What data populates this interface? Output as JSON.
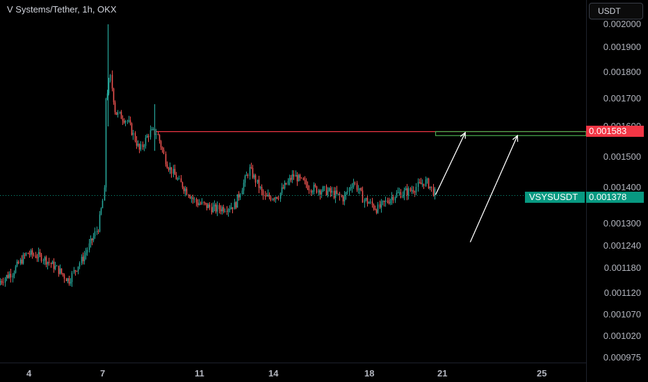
{
  "header": {
    "symbol_title": "V Systems/Tether, 1h, OKX",
    "currency_button": "USDT"
  },
  "colors": {
    "background": "#000000",
    "up": "#26a69a",
    "down": "#ef5350",
    "resistance_line": "#f23645",
    "current_price": "#089981"
  },
  "price_axis": {
    "labels": [
      "0.002000",
      "0.001900",
      "0.001800",
      "0.001700",
      "0.001600",
      "0.001500",
      "0.001400",
      "0.001300",
      "0.001240",
      "0.001180",
      "0.001120",
      "0.001070",
      "0.001020",
      "0.000975"
    ]
  },
  "price_tags": {
    "resistance_value": "0.001583",
    "ticker_label": "VSYSUSDT",
    "last_price": "0.001378"
  },
  "time_axis": {
    "labels": [
      "4",
      "7",
      "11",
      "14",
      "18",
      "21",
      "25"
    ]
  },
  "chart_data": {
    "type": "candlestick",
    "title": "V Systems/Tether, 1h, OKX",
    "x_unit": "day of month",
    "x_ticks": [
      "4",
      "7",
      "11",
      "14",
      "18",
      "21",
      "25"
    ],
    "y_ticks": [
      0.002,
      0.0019,
      0.0018,
      0.0017,
      0.0016,
      0.0015,
      0.0014,
      0.0013,
      0.00124,
      0.00118,
      0.00112,
      0.00107,
      0.00102,
      0.000975
    ],
    "price_path": [
      [
        2.6,
        0.00114
      ],
      [
        3.3,
        0.00117
      ],
      [
        3.9,
        0.00122
      ],
      [
        4.5,
        0.00121
      ],
      [
        5.1,
        0.00118
      ],
      [
        5.6,
        0.00115
      ],
      [
        6.2,
        0.00121
      ],
      [
        6.8,
        0.00129
      ],
      [
        7.05,
        0.00139
      ],
      [
        7.1,
        0.0017
      ],
      [
        7.3,
        0.00178
      ],
      [
        7.5,
        0.00165
      ],
      [
        8.0,
        0.00162
      ],
      [
        8.5,
        0.00152
      ],
      [
        8.9,
        0.00158
      ],
      [
        9.2,
        0.00158
      ],
      [
        9.6,
        0.00148
      ],
      [
        10.1,
        0.00142
      ],
      [
        10.8,
        0.00136
      ],
      [
        11.6,
        0.00134
      ],
      [
        12.4,
        0.00135
      ],
      [
        13.0,
        0.00146
      ],
      [
        13.6,
        0.00137
      ],
      [
        14.2,
        0.00138
      ],
      [
        14.8,
        0.00144
      ],
      [
        15.5,
        0.0014
      ],
      [
        16.2,
        0.00139
      ],
      [
        16.9,
        0.00137
      ],
      [
        17.3,
        0.00142
      ],
      [
        17.7,
        0.00137
      ],
      [
        18.3,
        0.00134
      ],
      [
        19.0,
        0.00138
      ],
      [
        19.6,
        0.00139
      ],
      [
        20.3,
        0.00142
      ],
      [
        20.7,
        0.001378
      ]
    ],
    "spikes": [
      {
        "x": 7.2,
        "high": 0.002,
        "low": 0.0016
      },
      {
        "x": 9.1,
        "high": 0.00168,
        "low": 0.00152
      }
    ],
    "last_price": 0.001378,
    "horizontal_level": {
      "price": 0.001583,
      "from_x": 9.2
    },
    "zone": {
      "from_x": 20.7,
      "top": 0.001583,
      "bottom": 0.00157
    },
    "arrows": [
      {
        "from": [
          20.7,
          0.00138
        ],
        "to": [
          21.9,
          0.00158
        ]
      },
      {
        "from": [
          22.1,
          0.00125
        ],
        "to": [
          24.0,
          0.00157
        ]
      }
    ],
    "grid": false
  }
}
